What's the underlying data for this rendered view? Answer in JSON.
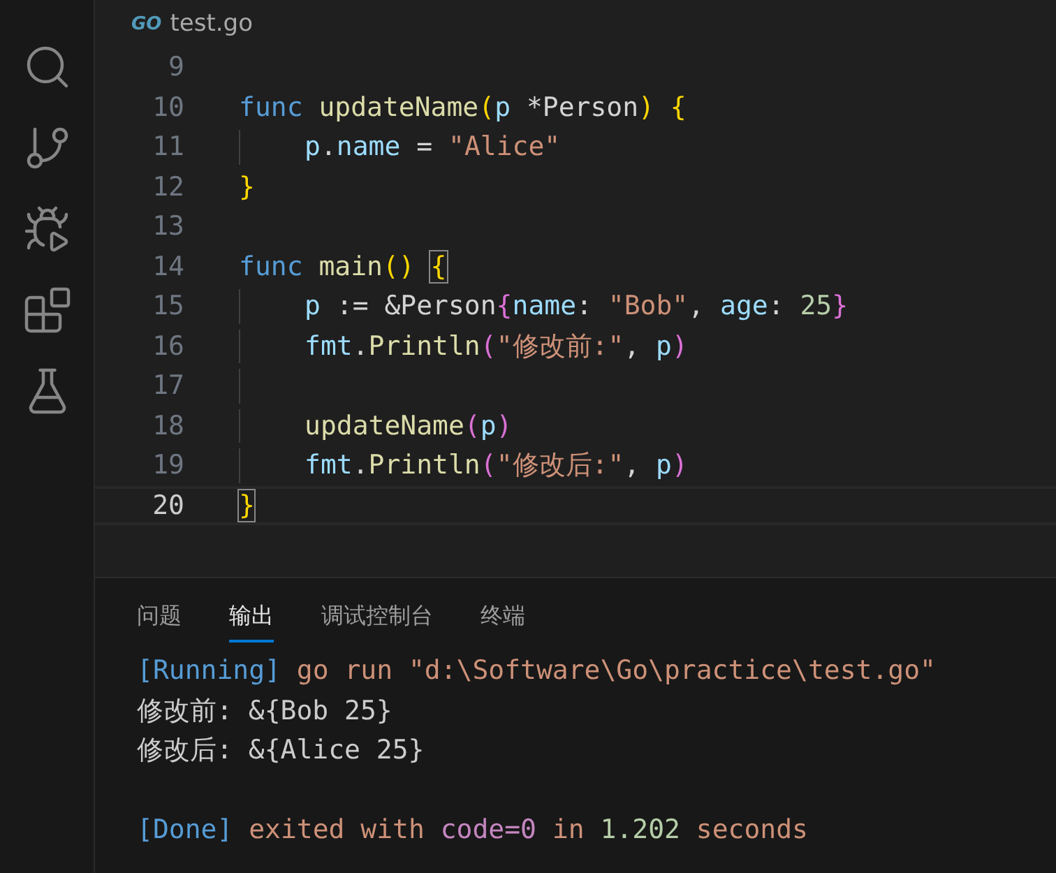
{
  "breadcrumb": {
    "logo": "GO",
    "file": "test.go"
  },
  "editor": {
    "lines": [
      {
        "number": "9",
        "current": false,
        "indented": false
      },
      {
        "number": "10",
        "current": false,
        "indented": false,
        "tokens": [
          {
            "text": "func",
            "kind": "keyword"
          },
          {
            "text": " updateName",
            "kind": "function"
          },
          {
            "text": "(",
            "kind": "bracket1"
          },
          {
            "text": "p",
            "kind": "variable"
          },
          {
            "text": " *Person",
            "kind": "plain"
          },
          {
            "text": ") {",
            "kind": "bracket1"
          }
        ]
      },
      {
        "number": "11",
        "current": false,
        "indented": true,
        "tokens": [
          {
            "text": "p",
            "kind": "variable"
          },
          {
            "text": ".",
            "kind": "plain"
          },
          {
            "text": "name",
            "kind": "variable"
          },
          {
            "text": " = ",
            "kind": "plain"
          },
          {
            "text": "\"Alice\"",
            "kind": "string"
          }
        ]
      },
      {
        "number": "12",
        "current": false,
        "indented": false,
        "tokens": [
          {
            "text": "}",
            "kind": "bracket1"
          }
        ]
      },
      {
        "number": "13",
        "current": false,
        "indented": false
      },
      {
        "number": "14",
        "current": false,
        "indented": false,
        "tokens": [
          {
            "text": "func",
            "kind": "keyword"
          },
          {
            "text": " main",
            "kind": "function"
          },
          {
            "text": "() ",
            "kind": "bracket1"
          },
          {
            "text": "{",
            "kind": "bracket1",
            "matched": true
          }
        ]
      },
      {
        "number": "15",
        "current": false,
        "indented": true,
        "tokens": [
          {
            "text": "p",
            "kind": "variable"
          },
          {
            "text": " := &Person",
            "kind": "plain"
          },
          {
            "text": "{",
            "kind": "bracket2"
          },
          {
            "text": "name",
            "kind": "variable"
          },
          {
            "text": ": ",
            "kind": "plain"
          },
          {
            "text": "\"Bob\"",
            "kind": "string"
          },
          {
            "text": ", ",
            "kind": "plain"
          },
          {
            "text": "age",
            "kind": "variable"
          },
          {
            "text": ": ",
            "kind": "plain"
          },
          {
            "text": "25",
            "kind": "number"
          },
          {
            "text": "}",
            "kind": "bracket2"
          }
        ]
      },
      {
        "number": "16",
        "current": false,
        "indented": true,
        "tokens": [
          {
            "text": "fmt",
            "kind": "variable"
          },
          {
            "text": ".",
            "kind": "plain"
          },
          {
            "text": "Println",
            "kind": "function"
          },
          {
            "text": "(",
            "kind": "bracket2"
          },
          {
            "text": "\"修改前:\"",
            "kind": "string"
          },
          {
            "text": ", ",
            "kind": "plain"
          },
          {
            "text": "p",
            "kind": "variable"
          },
          {
            "text": ")",
            "kind": "bracket2"
          }
        ]
      },
      {
        "number": "17",
        "current": false,
        "indented": true
      },
      {
        "number": "18",
        "current": false,
        "indented": true,
        "tokens": [
          {
            "text": "updateName",
            "kind": "function"
          },
          {
            "text": "(",
            "kind": "bracket2"
          },
          {
            "text": "p",
            "kind": "variable"
          },
          {
            "text": ")",
            "kind": "bracket2"
          }
        ]
      },
      {
        "number": "19",
        "current": false,
        "indented": true,
        "tokens": [
          {
            "text": "fmt",
            "kind": "variable"
          },
          {
            "text": ".",
            "kind": "plain"
          },
          {
            "text": "Println",
            "kind": "function"
          },
          {
            "text": "(",
            "kind": "bracket2"
          },
          {
            "text": "\"修改后:\"",
            "kind": "string"
          },
          {
            "text": ", ",
            "kind": "plain"
          },
          {
            "text": "p",
            "kind": "variable"
          },
          {
            "text": ")",
            "kind": "bracket2"
          }
        ]
      },
      {
        "number": "20",
        "current": true,
        "indented": false,
        "tokens": [
          {
            "text": "}",
            "kind": "bracket1",
            "matched": true
          }
        ]
      }
    ]
  },
  "panel": {
    "tabs": [
      {
        "label": "问题",
        "selected": false
      },
      {
        "label": "输出",
        "selected": true
      },
      {
        "label": "调试控制台",
        "selected": false
      },
      {
        "label": "终端",
        "selected": false
      }
    ],
    "output": [
      {
        "kind": "text",
        "spans": [
          {
            "text": "[Running]",
            "kind": "tag"
          },
          {
            "text": " go run \"d:\\Software\\Go\\practice\\test.go\"",
            "kind": "orange"
          }
        ]
      },
      {
        "kind": "text",
        "spans": [
          {
            "text": "修改前: &{Bob 25}",
            "kind": "plain"
          }
        ]
      },
      {
        "kind": "text",
        "spans": [
          {
            "text": "修改后: &{Alice 25}",
            "kind": "plain"
          }
        ]
      },
      {
        "kind": "blank"
      },
      {
        "kind": "text",
        "spans": [
          {
            "text": "[Done]",
            "kind": "tag"
          },
          {
            "text": " exited with ",
            "kind": "orange"
          },
          {
            "text": "code=0",
            "kind": "purple"
          },
          {
            "text": " in ",
            "kind": "orange"
          },
          {
            "text": "1.202",
            "kind": "number"
          },
          {
            "text": " seconds",
            "kind": "orange"
          }
        ]
      }
    ]
  }
}
